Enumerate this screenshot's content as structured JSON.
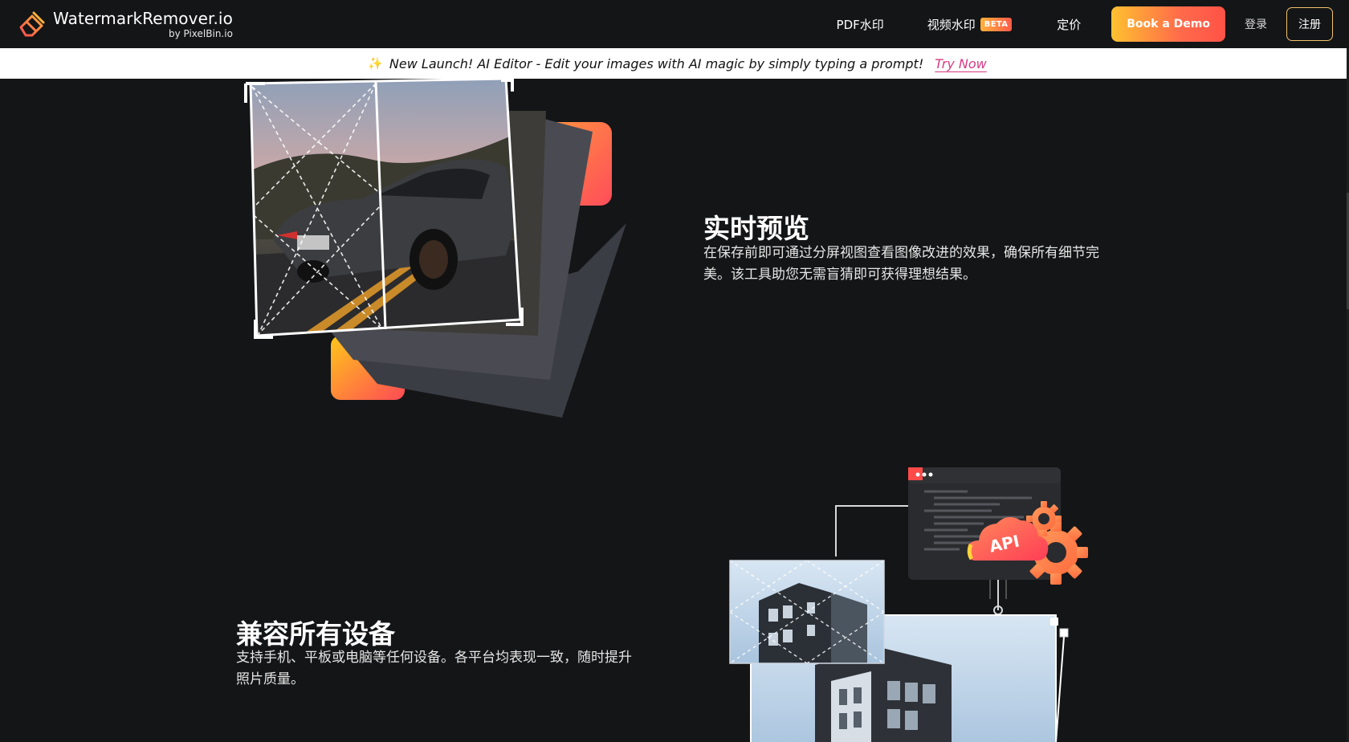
{
  "nav": {
    "brand_name": "WatermarkRemover.io",
    "brand_sub": "by PixelBin.io",
    "pdf_link": "PDF水印",
    "video_link": "视频水印",
    "beta_badge": "BETA",
    "pricing_link": "定价",
    "demo_button": "Book a Demo",
    "login_link": "登录",
    "signup_button": "注册"
  },
  "banner": {
    "star": "✨",
    "text": "New Launch! AI Editor - Edit your images with AI magic by simply typing a prompt!",
    "link": "Try Now"
  },
  "features": [
    {
      "title": "实时预览",
      "description": "在保存前即可通过分屏视图查看图像改进的效果，确保所有细节完美。该工具助您无需盲猜即可获得理想结果。"
    },
    {
      "title": "兼容所有设备",
      "description": "支持手机、平板或电脑等任何设备。各平台均表现一致，随时提升照片质量。"
    }
  ],
  "api_illustration": {
    "cloud_label": "API"
  },
  "colors": {
    "background": "#141517",
    "accent_orange": "#ff6b4a",
    "accent_yellow": "#ffc130",
    "link_pink": "#d63a85"
  }
}
